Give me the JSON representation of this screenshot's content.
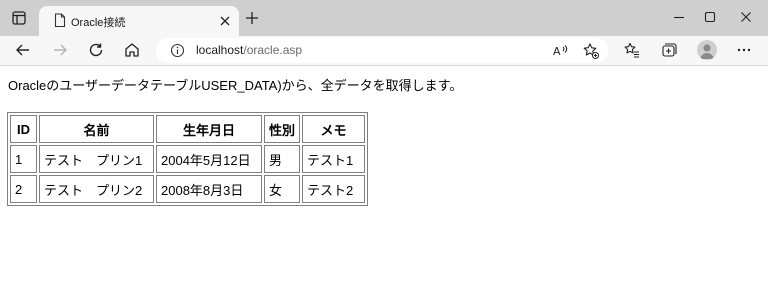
{
  "browser": {
    "tab_title": "Oracle接続",
    "url_host": "localhost",
    "url_path": "/oracle.asp"
  },
  "page": {
    "intro": "OracleのユーザーデータテーブルUSER_DATA)から、全データを取得します。",
    "table": {
      "headers": [
        "ID",
        "名前",
        "生年月日",
        "性別",
        "メモ"
      ],
      "rows": [
        [
          "1",
          "テスト　プリン1",
          "2004年5月12日",
          "男",
          "テスト1"
        ],
        [
          "2",
          "テスト　プリン2",
          "2008年8月3日",
          "女",
          "テスト2"
        ]
      ]
    }
  }
}
